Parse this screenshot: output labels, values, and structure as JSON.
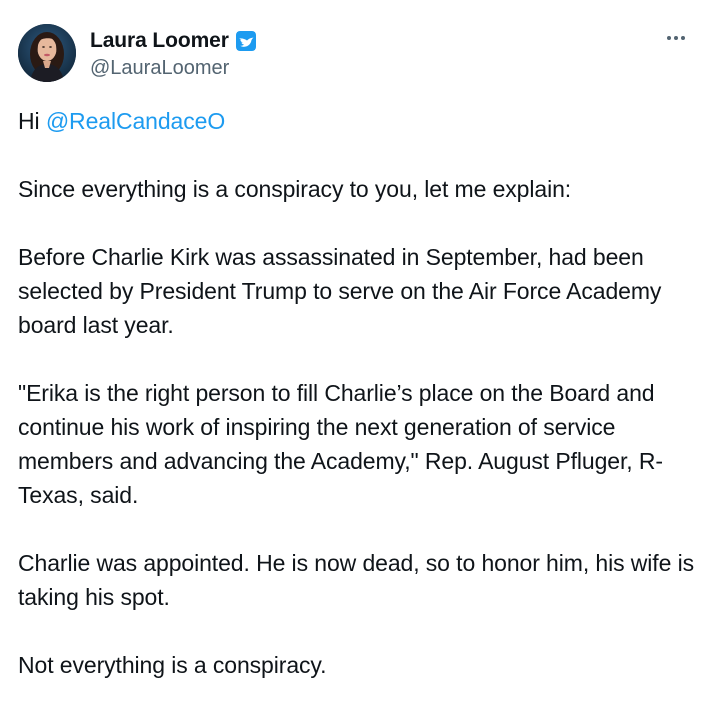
{
  "author": {
    "display_name": "Laura Loomer",
    "handle": "@LauraLoomer",
    "verified_icon": "verified-badge-icon",
    "avatar": "profile-photo"
  },
  "menu": {
    "icon": "more-options-icon"
  },
  "tweet": {
    "greeting": "Hi ",
    "mention": "@RealCandaceO",
    "p1": "Since everything is a conspiracy to you, let me explain:",
    "p2": "Before Charlie Kirk was assassinated in September, had been selected by President Trump to serve on the Air Force Academy board last year.",
    "p3": "\"Erika is the right person to fill Charlie’s place on the Board and continue his work of inspiring the next generation of service members and advancing the Academy,\" Rep. August Pfluger, R-Texas, said.",
    "p4": "Charlie was appointed. He is now dead, so to honor him, his wife is taking his spot.",
    "p5": "Not everything is a conspiracy."
  },
  "colors": {
    "accent": "#1d9bf0",
    "text": "#0f1419",
    "secondary": "#536471"
  }
}
